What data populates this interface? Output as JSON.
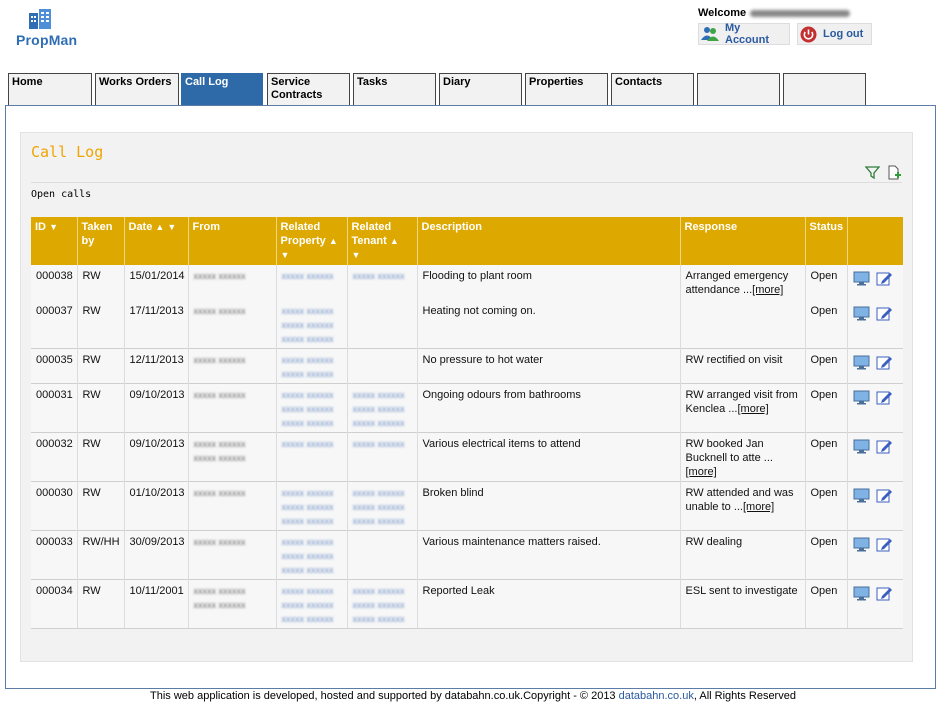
{
  "logo": {
    "text": "PropMan"
  },
  "header": {
    "welcome_label": "Welcome",
    "my_account_label": "My Account",
    "logout_label": "Log out"
  },
  "tabs": [
    {
      "line1": "Home",
      "line2": ""
    },
    {
      "line1": "Works Orders",
      "line2": ""
    },
    {
      "line1": "Call Log",
      "line2": ""
    },
    {
      "line1": "Service",
      "line2": "Contracts"
    },
    {
      "line1": "Tasks",
      "line2": ""
    },
    {
      "line1": "Diary",
      "line2": ""
    },
    {
      "line1": "Properties",
      "line2": ""
    },
    {
      "line1": "Contacts",
      "line2": ""
    },
    {
      "line1": "",
      "line2": ""
    },
    {
      "line1": "",
      "line2": ""
    }
  ],
  "panel": {
    "title": "Call Log",
    "subtitle": "Open calls"
  },
  "columns": {
    "id": "ID",
    "taken_by": "Taken by",
    "date": "Date",
    "from": "From",
    "related_property": "Related Property",
    "related_tenant": "Related Tenant",
    "description": "Description",
    "response": "Response",
    "status": "Status"
  },
  "rows": [
    {
      "id": "000038",
      "taken_by": "RW",
      "date": "15/01/2014",
      "description": "Flooding to plant room",
      "response": "Arranged emergency attendance ...",
      "more": "[more]",
      "status": "Open"
    },
    {
      "id": "000037",
      "taken_by": "RW",
      "date": "17/11/2013",
      "description": "Heating not coming on.",
      "response": "",
      "more": "",
      "status": "Open"
    },
    {
      "id": "000035",
      "taken_by": "RW",
      "date": "12/11/2013",
      "description": "No pressure to hot water",
      "response": "RW rectified on visit",
      "more": "",
      "status": "Open"
    },
    {
      "id": "000031",
      "taken_by": "RW",
      "date": "09/10/2013",
      "description": "Ongoing odours from bathrooms",
      "response": "RW arranged visit from Kenclea ...",
      "more": "[more]",
      "status": "Open"
    },
    {
      "id": "000032",
      "taken_by": "RW",
      "date": "09/10/2013",
      "description": "Various electrical items to attend",
      "response": "RW booked Jan Bucknell to atte ...",
      "more": "[more]",
      "status": "Open"
    },
    {
      "id": "000030",
      "taken_by": "RW",
      "date": "01/10/2013",
      "description": "Broken blind",
      "response": "RW attended and was unable to ...",
      "more": "[more]",
      "status": "Open"
    },
    {
      "id": "000033",
      "taken_by": "RW/HH",
      "date": "30/09/2013",
      "description": "Various maintenance matters raised.",
      "response": "RW dealing",
      "more": "",
      "status": "Open"
    },
    {
      "id": "000034",
      "taken_by": "RW",
      "date": "10/11/2001",
      "description": "Reported Leak",
      "response": "ESL sent to investigate",
      "more": "",
      "status": "Open"
    }
  ],
  "footer": {
    "text": "This web application is developed, hosted and supported by databahn.co.uk.Copyright - © 2013",
    "link": "databahn.co.uk",
    "suffix": ", All Rights Reserved"
  },
  "colors": {
    "accent": "#dda800",
    "active_tab": "#2e6aa8",
    "title": "#f0a500",
    "link": "#2a5aa0"
  },
  "icons": [
    "building-logo-icon",
    "users-icon",
    "power-icon",
    "filter-icon",
    "add-file-icon",
    "monitor-view-icon",
    "edit-pencil-icon"
  ]
}
